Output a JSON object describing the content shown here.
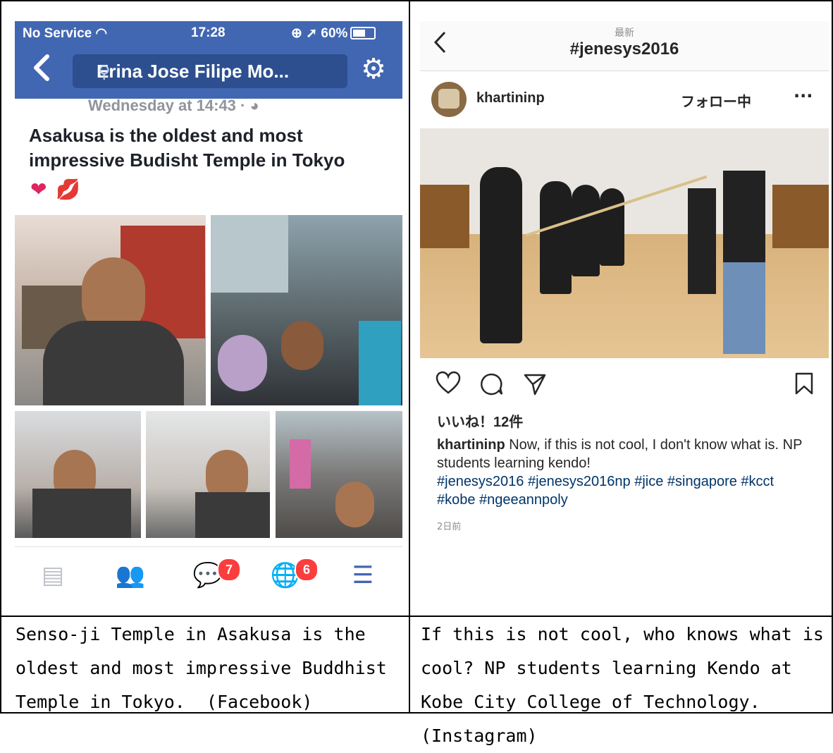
{
  "facebook": {
    "status": {
      "carrier": "No Service",
      "time": "17:28",
      "battery": "60%"
    },
    "search_text": "Erina Jose Filipe Mo...",
    "post_time": "Wednesday at 14:43 · ",
    "post_text": "Asakusa is the oldest and most impressive Budisht Temple in Tokyo",
    "tabbar": {
      "messages_badge": "7",
      "notifications_badge": "6"
    }
  },
  "instagram": {
    "header_sub": "最新",
    "header_title": "#jenesys2016",
    "username": "khartininp",
    "follow_label": "フォロー中",
    "likes": "いいね！12件",
    "caption_user": "khartininp",
    "caption_text": " Now, if this is not cool, I don't know what is. NP students learning kendo!",
    "hashtags": "#jenesys2016 #jenesys2016np #jice #singapore #kcct #kobe #ngeeannpoly",
    "time_ago": "2日前"
  },
  "captions": {
    "left": "Senso-ji Temple in Asakusa is the oldest and most impressive Buddhist Temple in Tokyo.  (Facebook)",
    "right": "If this is not cool, who knows what is cool? NP students learning Kendo at Kobe City College of Technology. (Instagram)"
  },
  "colors": {
    "fb_blue": "#4267b2",
    "badge_red": "#fa3e3e",
    "ig_link": "#003569"
  }
}
